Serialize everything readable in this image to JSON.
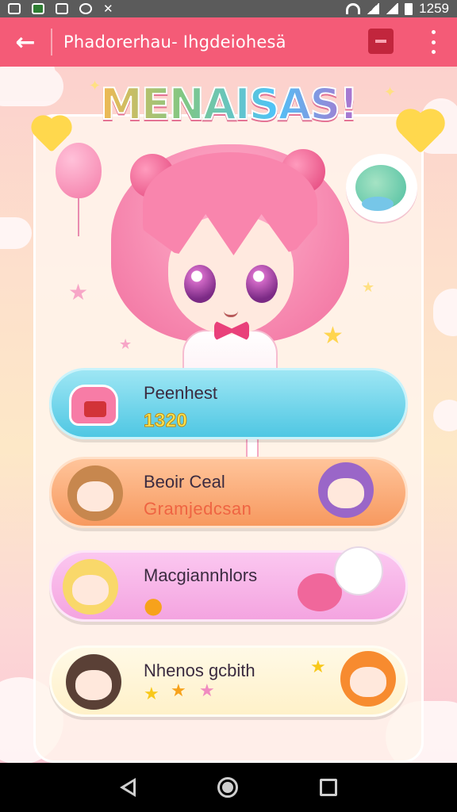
{
  "status_bar": {
    "time": "1259"
  },
  "app_bar": {
    "title": "Phadorerhau‐ Ihgdeiohesä"
  },
  "logo": {
    "text": "MENAISAS!"
  },
  "menu": [
    {
      "title": "Peenhest",
      "subtitle": "1320",
      "thumb": "jar-icon"
    },
    {
      "title": "Beoir Ceal",
      "subtitle": "Gramjedcsan",
      "thumb": "character-brown"
    },
    {
      "title": "Macgiannhlors",
      "subtitle": "",
      "thumb": "character-blond"
    },
    {
      "title": "Nhenos gcbith",
      "subtitle": "",
      "thumb": "character-dark"
    }
  ],
  "colors": {
    "app_bar": "#f45b77",
    "row1": "#4fc7e3",
    "row2": "#f7995f",
    "row3": "#f4a4e0",
    "row4": "#fff1c9"
  }
}
